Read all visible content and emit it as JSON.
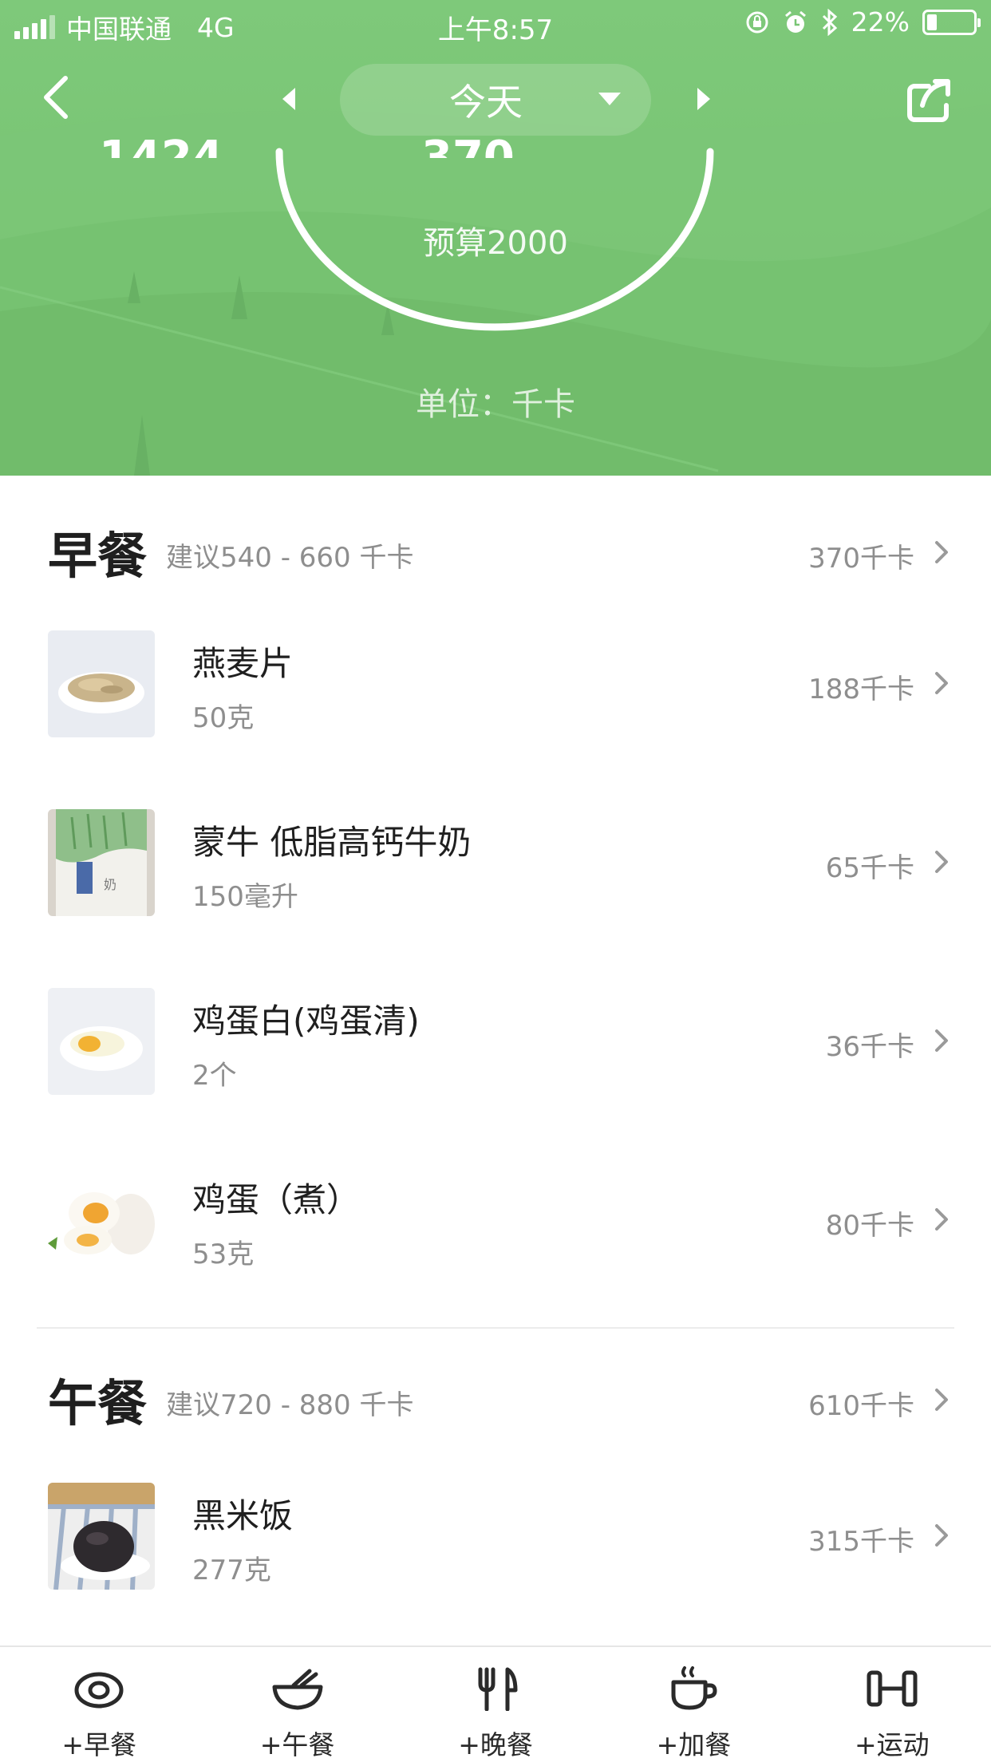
{
  "status_bar": {
    "carrier": "中国联通",
    "network": "4G",
    "time": "上午8:57",
    "battery_percent": "22%",
    "battery_level": 0.22
  },
  "nav": {
    "date_label": "今天"
  },
  "summary": {
    "left_value_partial": "1424",
    "center_value_partial": "370",
    "budget": "预算2000",
    "unit": "单位：千卡"
  },
  "meals": [
    {
      "title": "早餐",
      "suggest": "建议540 - 660 千卡",
      "total": "370千卡",
      "items": [
        {
          "name": "燕麦片",
          "amount": "50克",
          "kcal": "188千卡",
          "thumb": "oats"
        },
        {
          "name": "蒙牛 低脂高钙牛奶",
          "amount": "150毫升",
          "kcal": "65千卡",
          "thumb": "milk"
        },
        {
          "name": "鸡蛋白(鸡蛋清)",
          "amount": "2个",
          "kcal": "36千卡",
          "thumb": "egg-white"
        },
        {
          "name": "鸡蛋（煮）",
          "amount": "53克",
          "kcal": "80千卡",
          "thumb": "boiled-egg"
        }
      ]
    },
    {
      "title": "午餐",
      "suggest": "建议720 - 880 千卡",
      "total": "610千卡",
      "items": [
        {
          "name": "黑米饭",
          "amount": "277克",
          "kcal": "315千卡",
          "thumb": "black-rice"
        }
      ]
    }
  ],
  "tabbar": [
    {
      "label": "+早餐",
      "icon": "eye-icon"
    },
    {
      "label": "+午餐",
      "icon": "bowl-icon"
    },
    {
      "label": "+晚餐",
      "icon": "fork-knife-icon"
    },
    {
      "label": "+加餐",
      "icon": "cup-icon"
    },
    {
      "label": "+运动",
      "icon": "dumbbell-icon"
    }
  ],
  "colors": {
    "header_green": "#7ec97a",
    "text_primary": "#1f1f1f",
    "text_secondary": "#8e8e8e"
  }
}
